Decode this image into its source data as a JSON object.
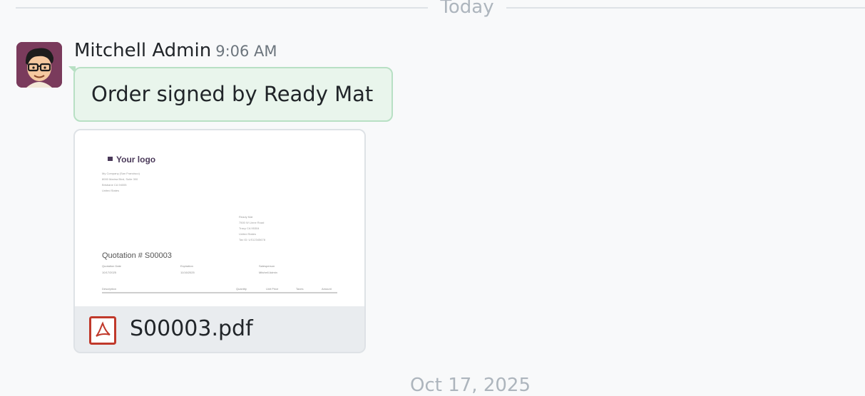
{
  "divider": {
    "label": "Today"
  },
  "message": {
    "author": "Mitchell Admin",
    "time": "9:06 AM",
    "body": "Order signed by Ready Mat"
  },
  "attachment": {
    "file_name": "S00003.pdf",
    "icon": "pdf-icon",
    "preview": {
      "logo_text": "Your logo",
      "company_lines": [
        "My Company (San Francisco)",
        "8000 Marina Blvd, Suite 300",
        "Brisbane CA 94005",
        "United States"
      ],
      "customer_lines": [
        "Ready Mat",
        "7500 W Linne Road",
        "Tracy CA 95304",
        "United States",
        "Tax ID: US12345678"
      ],
      "title": "Quotation # S00003",
      "info_labels": [
        "Quotation Date",
        "Expiration",
        "Salesperson"
      ],
      "info_values": [
        "10/17/2025",
        "11/16/2025",
        "Mitchell Admin"
      ],
      "table_headers": [
        "Description",
        "Quantity",
        "Unit Price",
        "Taxes",
        "Amount"
      ]
    }
  },
  "next_divider": {
    "label": "Oct 17, 2025"
  },
  "colors": {
    "bubble_bg": "#e9f5ec",
    "bubble_border": "#b8e0c4",
    "pdf_red": "#c0392b",
    "muted_text": "#adb5bd"
  }
}
